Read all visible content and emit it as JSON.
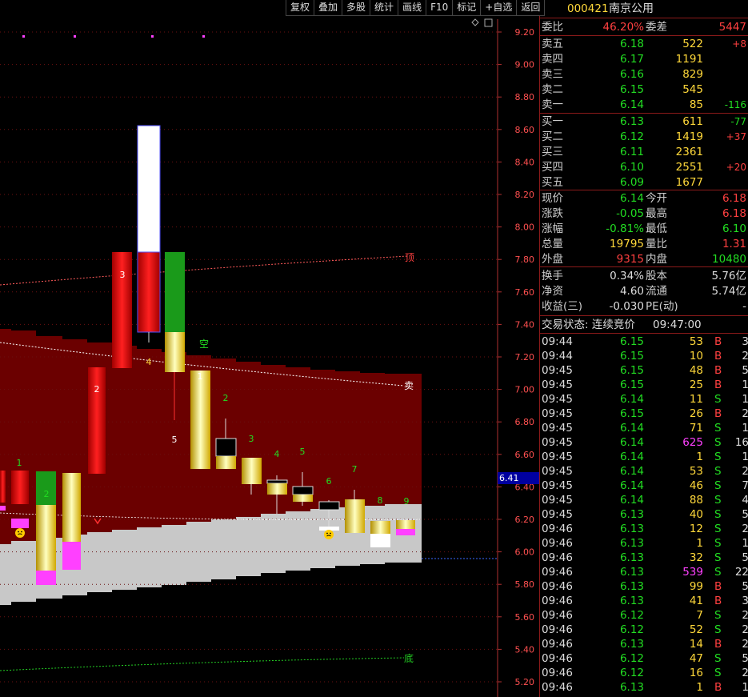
{
  "toolbar": [
    "复权",
    "叠加",
    "多股",
    "统计",
    "画线",
    "F10",
    "标记",
    "+自选",
    "返回"
  ],
  "axis": {
    "labels": [
      "9.20",
      "9.00",
      "8.80",
      "8.60",
      "8.40",
      "8.20",
      "8.00",
      "7.80",
      "7.60",
      "7.40",
      "7.20",
      "7.00",
      "6.80",
      "6.60",
      "6.40",
      "6.20",
      "6.00",
      "5.80",
      "5.60",
      "5.40",
      "5.20"
    ]
  },
  "current_price_label": "6.41",
  "chart_text": {
    "top_label": "顶",
    "sell_label": "卖",
    "bottom_label": "底",
    "empty_label": "空",
    "counts": [
      "1",
      "2",
      "2",
      "3",
      "4",
      "1",
      "2",
      "3",
      "4",
      "5",
      "5",
      "6",
      "7",
      "8",
      "9"
    ]
  },
  "stock": {
    "code": "000421",
    "name": "南京公用"
  },
  "commission": {
    "ratio_label": "委比",
    "ratio": "46.20%",
    "diff_label": "委差",
    "diff": "5447"
  },
  "sell_orders": [
    {
      "label": "卖五",
      "price": "6.18",
      "vol": "522",
      "chg": "+8"
    },
    {
      "label": "卖四",
      "price": "6.17",
      "vol": "1191",
      "chg": ""
    },
    {
      "label": "卖三",
      "price": "6.16",
      "vol": "829",
      "chg": ""
    },
    {
      "label": "卖二",
      "price": "6.15",
      "vol": "545",
      "chg": ""
    },
    {
      "label": "卖一",
      "price": "6.14",
      "vol": "85",
      "chg": "-116"
    }
  ],
  "buy_orders": [
    {
      "label": "买一",
      "price": "6.13",
      "vol": "611",
      "chg": "-77"
    },
    {
      "label": "买二",
      "price": "6.12",
      "vol": "1419",
      "chg": "+37"
    },
    {
      "label": "买三",
      "price": "6.11",
      "vol": "2361",
      "chg": ""
    },
    {
      "label": "买四",
      "price": "6.10",
      "vol": "2551",
      "chg": "+20"
    },
    {
      "label": "买五",
      "price": "6.09",
      "vol": "1677",
      "chg": ""
    }
  ],
  "quote": [
    {
      "l1": "现价",
      "v1": "6.14",
      "c1": "grn",
      "l2": "今开",
      "v2": "6.18",
      "c2": "red"
    },
    {
      "l1": "涨跌",
      "v1": "-0.05",
      "c1": "grn",
      "l2": "最高",
      "v2": "6.18",
      "c2": "red"
    },
    {
      "l1": "涨幅",
      "v1": "-0.81%",
      "c1": "grn",
      "l2": "最低",
      "v2": "6.10",
      "c2": "grn"
    },
    {
      "l1": "总量",
      "v1": "19795",
      "c1": "yel",
      "l2": "量比",
      "v2": "1.31",
      "c2": "red"
    },
    {
      "l1": "外盘",
      "v1": "9315",
      "c1": "red",
      "l2": "内盘",
      "v2": "10480",
      "c2": "grn"
    }
  ],
  "stats": [
    {
      "l1": "换手",
      "v1": "0.34%",
      "l2": "股本",
      "v2": "5.76亿"
    },
    {
      "l1": "净资",
      "v1": "4.60",
      "l2": "流通",
      "v2": "5.74亿"
    },
    {
      "l1": "收益(三)",
      "v1": "-0.030",
      "l2": "PE(动)",
      "v2": "-"
    }
  ],
  "trade_status": {
    "label": "交易状态: 连续竞价",
    "time": "09:47:00"
  },
  "ticks": [
    [
      "09:44",
      "6.15",
      "53",
      "B",
      "3"
    ],
    [
      "09:44",
      "6.15",
      "10",
      "B",
      "2"
    ],
    [
      "09:45",
      "6.15",
      "48",
      "B",
      "5"
    ],
    [
      "09:45",
      "6.15",
      "25",
      "B",
      "1"
    ],
    [
      "09:45",
      "6.14",
      "11",
      "S",
      "1"
    ],
    [
      "09:45",
      "6.15",
      "26",
      "B",
      "2"
    ],
    [
      "09:45",
      "6.14",
      "71",
      "S",
      "1"
    ],
    [
      "09:45",
      "6.14",
      "625",
      "S",
      "16"
    ],
    [
      "09:45",
      "6.14",
      "1",
      "S",
      "1"
    ],
    [
      "09:45",
      "6.14",
      "53",
      "S",
      "2"
    ],
    [
      "09:45",
      "6.14",
      "46",
      "S",
      "7"
    ],
    [
      "09:45",
      "6.14",
      "88",
      "S",
      "4"
    ],
    [
      "09:45",
      "6.13",
      "40",
      "S",
      "5"
    ],
    [
      "09:46",
      "6.13",
      "12",
      "S",
      "2"
    ],
    [
      "09:46",
      "6.13",
      "1",
      "S",
      "1"
    ],
    [
      "09:46",
      "6.13",
      "32",
      "S",
      "5"
    ],
    [
      "09:46",
      "6.13",
      "539",
      "S",
      "22"
    ],
    [
      "09:46",
      "6.13",
      "99",
      "B",
      "5"
    ],
    [
      "09:46",
      "6.13",
      "41",
      "B",
      "3"
    ],
    [
      "09:46",
      "6.12",
      "7",
      "S",
      "2"
    ],
    [
      "09:46",
      "6.12",
      "52",
      "S",
      "2"
    ],
    [
      "09:46",
      "6.13",
      "14",
      "B",
      "2"
    ],
    [
      "09:46",
      "6.12",
      "47",
      "S",
      "5"
    ],
    [
      "09:46",
      "6.12",
      "16",
      "S",
      "2"
    ],
    [
      "09:46",
      "6.13",
      "1",
      "B",
      "1"
    ]
  ],
  "colors": {
    "up": "#ff3030",
    "down": "#22dd22",
    "band": "#6b0000",
    "border": "#8b1a1a",
    "price": "#ffd83a"
  }
}
